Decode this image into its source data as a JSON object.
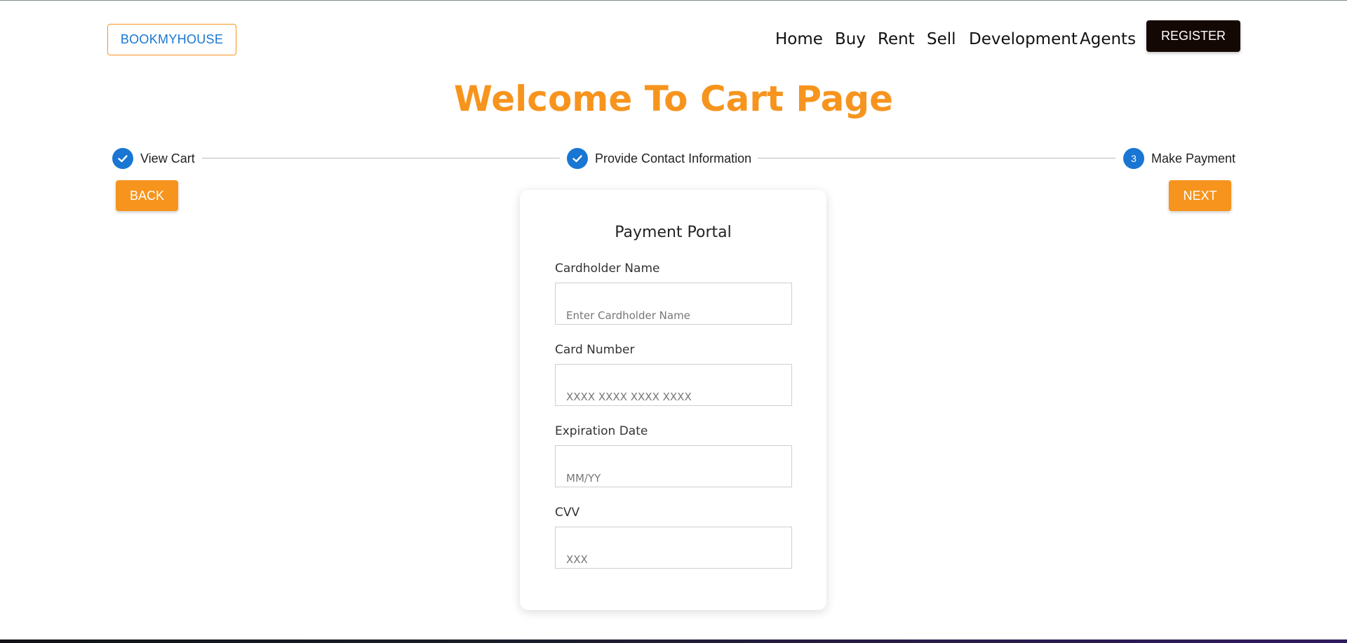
{
  "header": {
    "logo_label": "BOOKMYHOUSE",
    "nav": [
      {
        "label": "Home"
      },
      {
        "label": "Buy"
      },
      {
        "label": "Rent"
      },
      {
        "label": "Sell"
      },
      {
        "label": "Development"
      },
      {
        "label": "Agents"
      }
    ],
    "register_label": "REGISTER"
  },
  "page": {
    "title": "Welcome To Cart Page"
  },
  "stepper": {
    "steps": [
      {
        "label": "View Cart",
        "state": "completed",
        "icon": "check-icon"
      },
      {
        "label": "Provide Contact Information",
        "state": "completed",
        "icon": "check-icon"
      },
      {
        "label": "Make Payment",
        "state": "active",
        "number": "3"
      }
    ]
  },
  "actions": {
    "back_label": "BACK",
    "next_label": "NEXT"
  },
  "payment": {
    "title": "Payment Portal",
    "fields": [
      {
        "label": "Cardholder Name",
        "placeholder": "Enter Cardholder Name",
        "value": ""
      },
      {
        "label": "Card Number",
        "placeholder": "XXXX XXXX XXXX XXXX",
        "value": ""
      },
      {
        "label": "Expiration Date",
        "placeholder": "MM/YY",
        "value": ""
      },
      {
        "label": "CVV",
        "placeholder": "XXX",
        "value": ""
      }
    ]
  },
  "colors": {
    "accent": "#f7941d",
    "primary": "#1976d2",
    "register_bg": "#140805"
  }
}
